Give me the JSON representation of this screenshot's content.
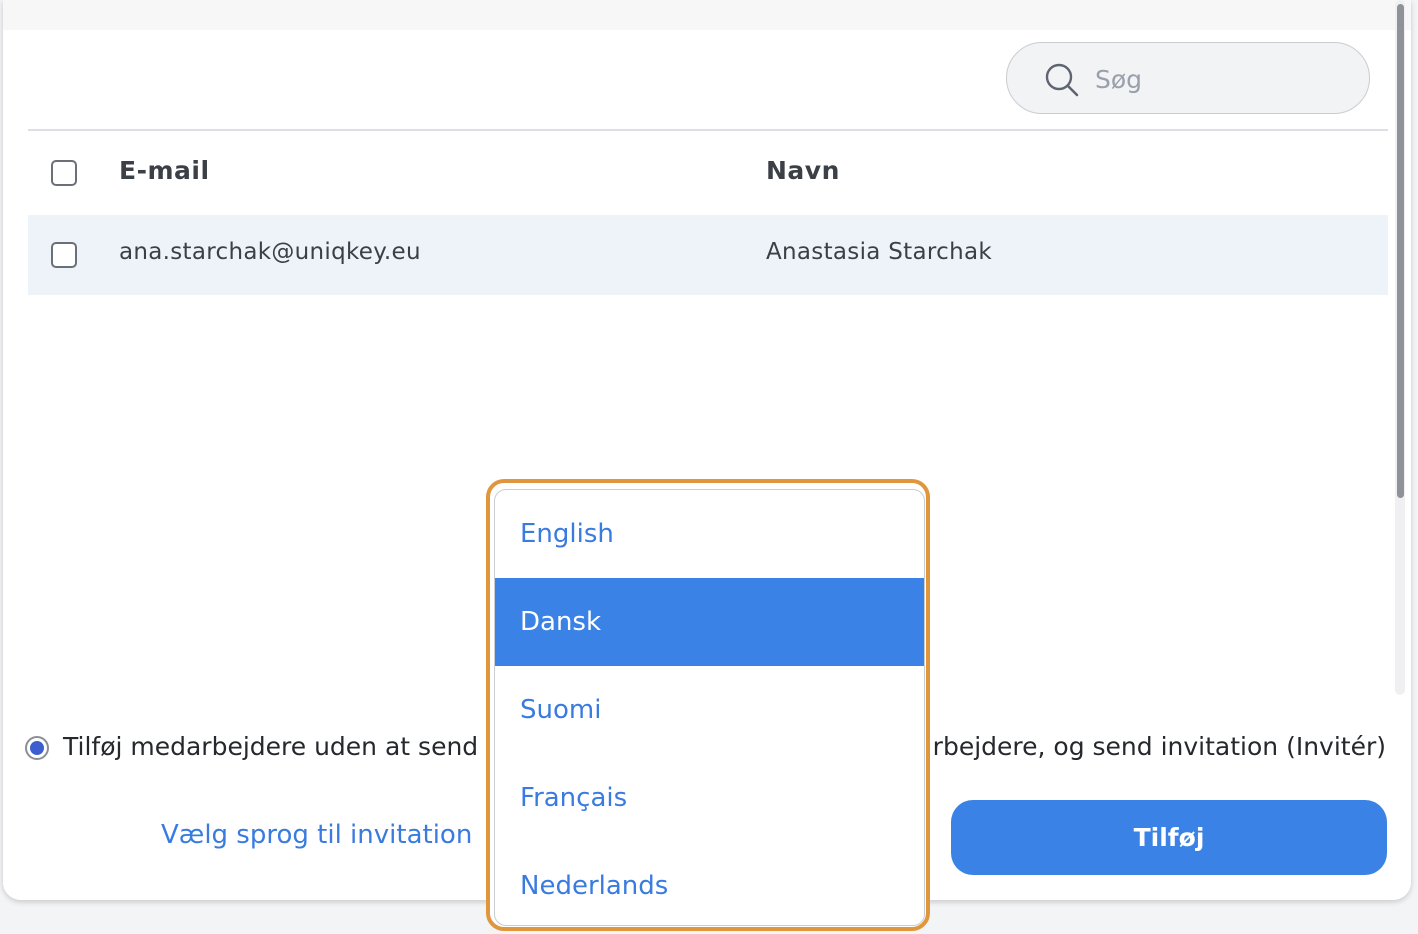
{
  "search": {
    "placeholder": "Søg",
    "value": ""
  },
  "table": {
    "headers": {
      "email": "E-mail",
      "name": "Navn"
    },
    "rows": [
      {
        "email": "ana.starchak@uniqkey.eu",
        "name": "Anastasia Starchak"
      }
    ]
  },
  "options": {
    "add_without_invite": "Tilføj medarbejdere uden at send",
    "add_and_invite": "rbejdere, og send invitation (Invitér)",
    "selected": "add_without_invite"
  },
  "language_link": "Vælg sprog til invitation",
  "add_button": "Tilføj",
  "language_dropdown": {
    "options": [
      "English",
      "Dansk",
      "Suomi",
      "Français",
      "Nederlands"
    ],
    "selected": "Dansk"
  },
  "colors": {
    "accent": "#3b82e6",
    "link": "#3a7be0",
    "highlight_border": "#e0963c",
    "row_highlight": "#eef2f9"
  },
  "icons": {
    "search": "search-icon"
  }
}
